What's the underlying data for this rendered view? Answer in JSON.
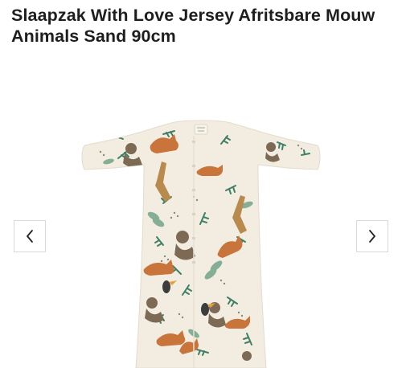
{
  "product": {
    "title": "Slaapzak With Love Jersey Afritsbare Mouw Animals Sand 90cm"
  },
  "gallery": {
    "prev_icon": "chevron-left-icon",
    "next_icon": "chevron-right-icon",
    "colors": {
      "fabric": "#f2ede0",
      "leaf": "#3f7f66",
      "fox": "#c8743a",
      "monkey": "#7d6a55"
    }
  }
}
